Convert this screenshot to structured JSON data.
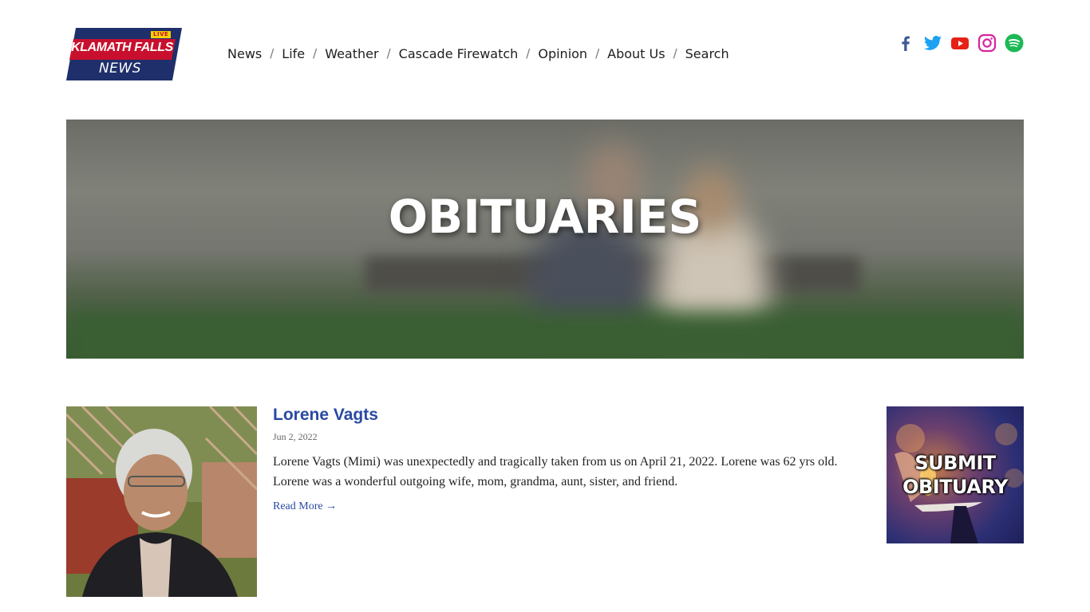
{
  "brand": {
    "logo_live": "LIVE",
    "logo_line1": "KLAMATH FALLS",
    "logo_line2": "NEWS"
  },
  "nav": {
    "items": [
      "News",
      "Life",
      "Weather",
      "Cascade Firewatch",
      "Opinion",
      "About Us",
      "Search"
    ],
    "separator": "/"
  },
  "social": {
    "icons": [
      "facebook-icon",
      "twitter-icon",
      "youtube-icon",
      "instagram-icon",
      "spotify-icon"
    ],
    "colors": {
      "facebook": "#3b5998",
      "twitter": "#1da1f2",
      "youtube": "#e62117",
      "instagram": "#d6249f",
      "spotify": "#1db954"
    }
  },
  "hero": {
    "title": "OBITUARIES"
  },
  "post": {
    "title": "Lorene Vagts",
    "date": "Jun 2, 2022",
    "excerpt": "Lorene Vagts (Mimi) was unexpectedly and tragically taken from us on April 21, 2022. Lorene was 62 yrs old. Lorene was a wonderful outgoing wife, mom, grandma, aunt, sister, and friend.",
    "read_more": "Read More →"
  },
  "promo": {
    "line1": "SUBMIT",
    "line2": "OBITUARY"
  },
  "colors": {
    "link": "#2a4aa2",
    "logo_red": "#c8102e",
    "logo_navy": "#1f2f6b",
    "logo_yellow": "#f5d000"
  }
}
